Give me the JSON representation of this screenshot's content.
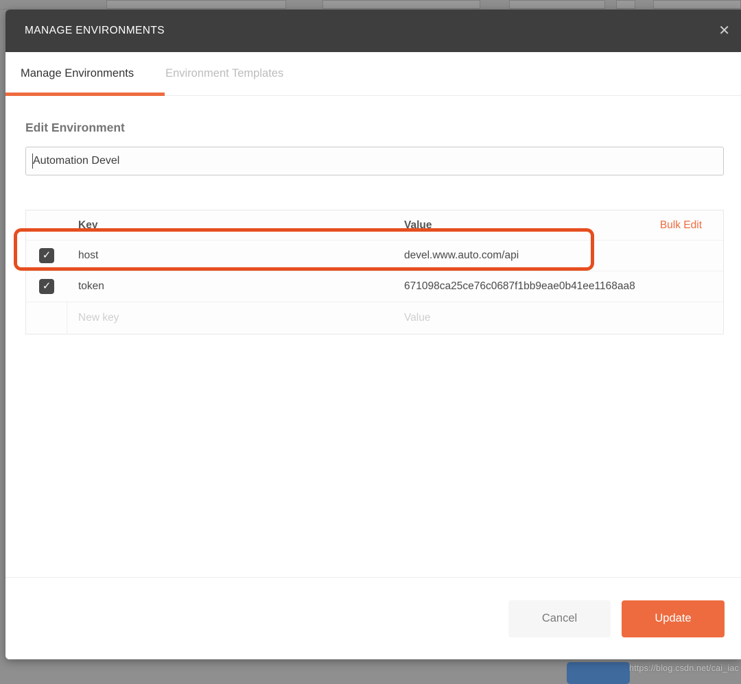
{
  "backdrop": {
    "watermark": "https://blog.csdn.net/cai_iac"
  },
  "icons": {
    "close": "✕",
    "check": "✓"
  },
  "colors": {
    "accent_orange": "#ee6b3f",
    "annotation_orange": "#e64e1f",
    "header_dark": "#3e3e3e",
    "backdrop_gray": "#8f8f8f",
    "background_blue_button": "#3e6a9e"
  },
  "modal": {
    "title": "MANAGE ENVIRONMENTS",
    "tabs": [
      {
        "label": "Manage Environments",
        "active": true
      },
      {
        "label": "Environment Templates",
        "active": false
      }
    ],
    "section_heading": "Edit Environment",
    "name_input": {
      "value": "Automation Devel"
    },
    "table": {
      "columns": {
        "key": "Key",
        "value": "Value"
      },
      "bulk_edit_label": "Bulk Edit",
      "rows": [
        {
          "key": "host",
          "value": "devel.www.auto.com/api",
          "checked": true,
          "highlighted": true
        },
        {
          "key": "token",
          "value": "671098ca25ce76c0687f1bb9eae0b41ee1168aa8",
          "checked": true,
          "highlighted": false
        }
      ],
      "new_row": {
        "key_placeholder": "New key",
        "value_placeholder": "Value"
      }
    },
    "footer": {
      "cancel_label": "Cancel",
      "update_label": "Update"
    }
  }
}
